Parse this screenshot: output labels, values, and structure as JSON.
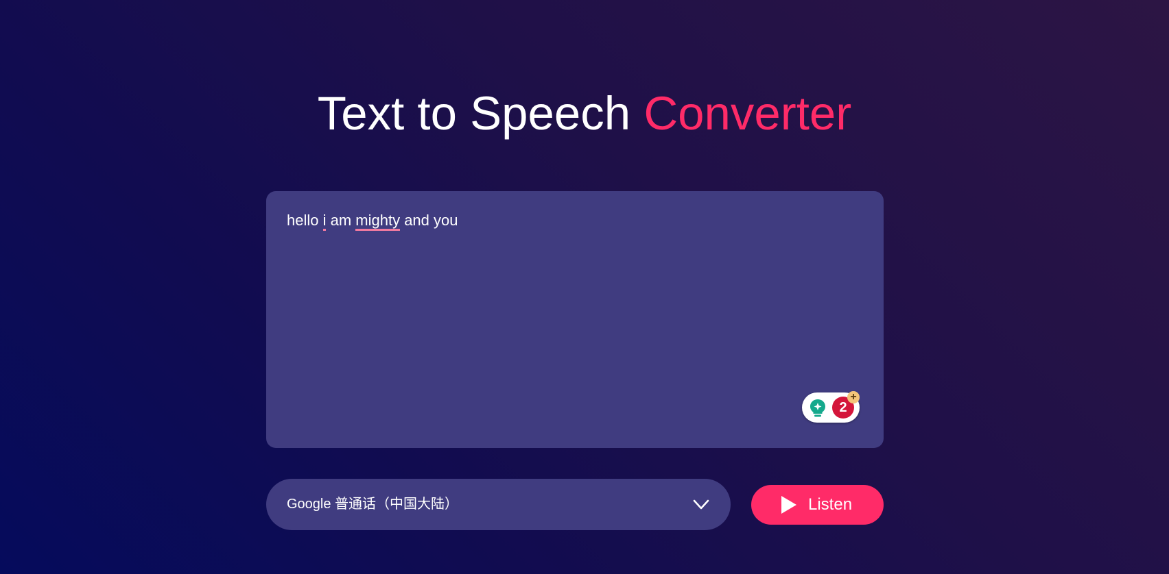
{
  "header": {
    "title_plain": "Text to Speech",
    "title_accent": "Converter"
  },
  "editor": {
    "segments": [
      {
        "text": "hello ",
        "misspelled": false
      },
      {
        "text": "i",
        "misspelled": true
      },
      {
        "text": " am ",
        "misspelled": false
      },
      {
        "text": "mighty",
        "misspelled": true
      },
      {
        "text": " and you",
        "misspelled": false
      }
    ]
  },
  "grammarly_widget": {
    "icon": "lightbulb-icon",
    "issue_count": "2",
    "badge_icon": "plus-icon",
    "badge_symbol": "+"
  },
  "voice_select": {
    "selected": "Google 普通话（中国大陆）",
    "icon": "chevron-down-icon"
  },
  "listen_button": {
    "label": "Listen",
    "icon": "play-icon"
  },
  "colors": {
    "accent": "#ff2b68",
    "panel": "#403c80",
    "spell_underline": "#f07aa0",
    "grammarly_red": "#d4153a",
    "grammarly_green": "#15a98c"
  }
}
